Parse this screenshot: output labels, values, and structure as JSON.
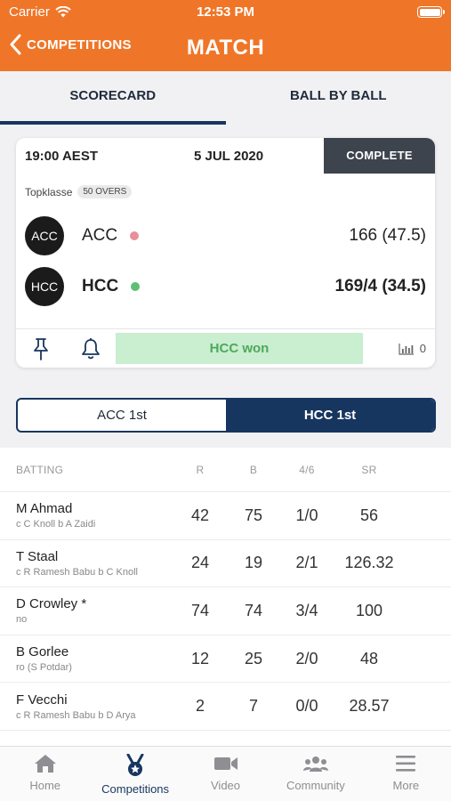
{
  "status_bar": {
    "carrier": "Carrier",
    "time": "12:53 PM"
  },
  "nav": {
    "back_label": "COMPETITIONS",
    "title": "MATCH"
  },
  "tabs": [
    {
      "label": "SCORECARD",
      "active": true
    },
    {
      "label": "BALL BY BALL",
      "active": false
    }
  ],
  "match": {
    "time": "19:00 AEST",
    "date": "5 JUL 2020",
    "status": "COMPLETE",
    "league": "Topklasse",
    "overs": "50 OVERS",
    "teams": [
      {
        "logo": "ACC",
        "name": "ACC",
        "dot_color": "#e8909a",
        "score": "166 (47.5)",
        "winner": false
      },
      {
        "logo": "HCC",
        "name": "HCC",
        "dot_color": "#5cbf74",
        "score": "169/4 (34.5)",
        "winner": true
      }
    ],
    "result": "HCC won",
    "stats_count": "0",
    "colors": {
      "status_bg": "#3d444e",
      "result_bg": "#c9eed0",
      "result_text": "#4ea85d"
    }
  },
  "innings": [
    {
      "label": "ACC 1st",
      "active": false
    },
    {
      "label": "HCC 1st",
      "active": true
    }
  ],
  "batting": {
    "headers": {
      "name": "BATTING",
      "r": "R",
      "b": "B",
      "fours_sixes": "4/6",
      "sr": "SR"
    },
    "rows": [
      {
        "name": "M Ahmad",
        "dismissal": "c C Knoll b A Zaidi",
        "r": "42",
        "b": "75",
        "fs": "1/0",
        "sr": "56"
      },
      {
        "name": "T Staal",
        "dismissal": "c R Ramesh Babu b C Knoll",
        "r": "24",
        "b": "19",
        "fs": "2/1",
        "sr": "126.32"
      },
      {
        "name": "D Crowley *",
        "dismissal": "no",
        "r": "74",
        "b": "74",
        "fs": "3/4",
        "sr": "100"
      },
      {
        "name": "B Gorlee",
        "dismissal": "ro (S Potdar)",
        "r": "12",
        "b": "25",
        "fs": "2/0",
        "sr": "48"
      },
      {
        "name": "F Vecchi",
        "dismissal": "c R Ramesh Babu b D Arya",
        "r": "2",
        "b": "7",
        "fs": "0/0",
        "sr": "28.57"
      }
    ]
  },
  "tabbar": [
    {
      "label": "Home",
      "icon": "home-icon",
      "active": false
    },
    {
      "label": "Competitions",
      "icon": "medal-icon",
      "active": true
    },
    {
      "label": "Video",
      "icon": "video-camera-icon",
      "active": false
    },
    {
      "label": "Community",
      "icon": "people-icon",
      "active": false
    },
    {
      "label": "More",
      "icon": "menu-icon",
      "active": false
    }
  ],
  "colors": {
    "brand_orange": "#ef7628",
    "navy": "#17365f"
  }
}
